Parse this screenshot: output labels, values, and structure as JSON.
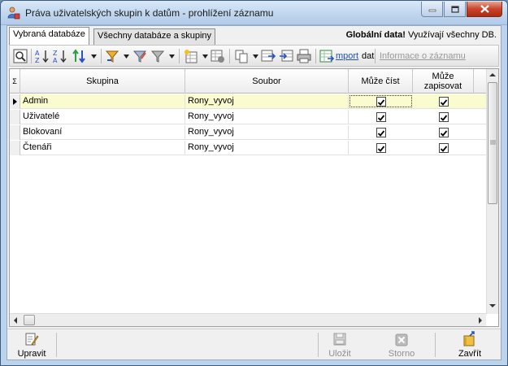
{
  "window": {
    "title": "Práva uživatelských skupin k datům - prohlížení záznamu",
    "controls": {
      "minimize": "minimize",
      "maximize": "maximize",
      "close": "close"
    }
  },
  "tabs": [
    {
      "label": "Vybraná databáze",
      "active": true
    },
    {
      "label": "Všechny databáze a skupiny",
      "active": false
    }
  ],
  "global_info": {
    "bold": "Globální data!",
    "rest": " Využívají všechny DB."
  },
  "toolbar": {
    "import_link": "mport",
    "import_suffix": "dat",
    "info_link": "Informace o záznamu"
  },
  "grid": {
    "indicator_header": "Σ",
    "columns": [
      "Skupina",
      "Soubor",
      "Může číst",
      "Může zapisovat"
    ],
    "rows": [
      {
        "skupina": "Admin",
        "soubor": "Rony_vyvoj",
        "cist": true,
        "zapisovat": true,
        "selected": true
      },
      {
        "skupina": "Uživatelé",
        "soubor": "Rony_vyvoj",
        "cist": true,
        "zapisovat": true,
        "selected": false
      },
      {
        "skupina": "Blokovaní",
        "soubor": "Rony_vyvoj",
        "cist": true,
        "zapisovat": true,
        "selected": false
      },
      {
        "skupina": "Čtenáři",
        "soubor": "Rony_vyvoj",
        "cist": true,
        "zapisovat": true,
        "selected": false
      }
    ]
  },
  "bottom_buttons": {
    "edit": "Upravit",
    "save": "Uložit",
    "cancel": "Storno",
    "close": "Zavřít"
  },
  "colors": {
    "selected_row": "#fbfbd0",
    "link": "#1f4fc0"
  }
}
